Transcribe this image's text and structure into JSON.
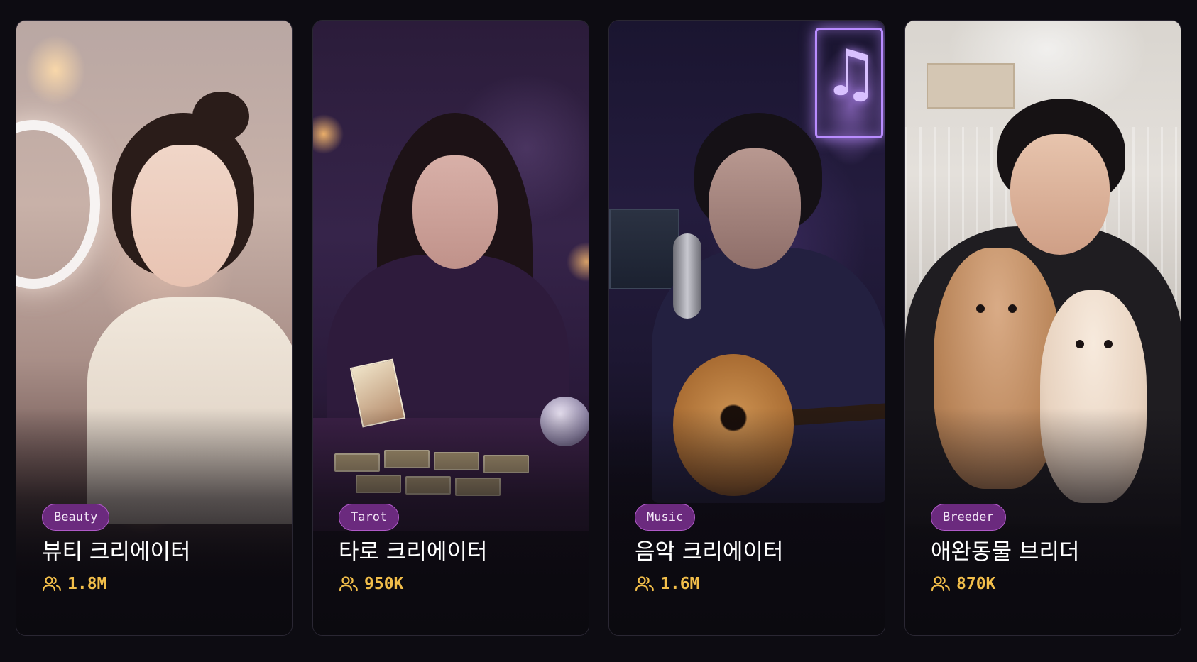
{
  "creators": [
    {
      "tag": "Beauty",
      "title": "뷰티 크리에이터",
      "followers": "1.8M",
      "icon": "users-icon"
    },
    {
      "tag": "Tarot",
      "title": "타로 크리에이터",
      "followers": "950K",
      "icon": "users-icon"
    },
    {
      "tag": "Music",
      "title": "음악 크리에이터",
      "followers": "1.6M",
      "icon": "users-icon"
    },
    {
      "tag": "Breeder",
      "title": "애완동물 브리더",
      "followers": "870K",
      "icon": "users-icon"
    }
  ],
  "colors": {
    "background": "#0d0c12",
    "tag_background": "#6b2a7e",
    "tag_border": "#b05ac8",
    "followers_text": "#f2be4a",
    "title_text": "#ffffff"
  }
}
